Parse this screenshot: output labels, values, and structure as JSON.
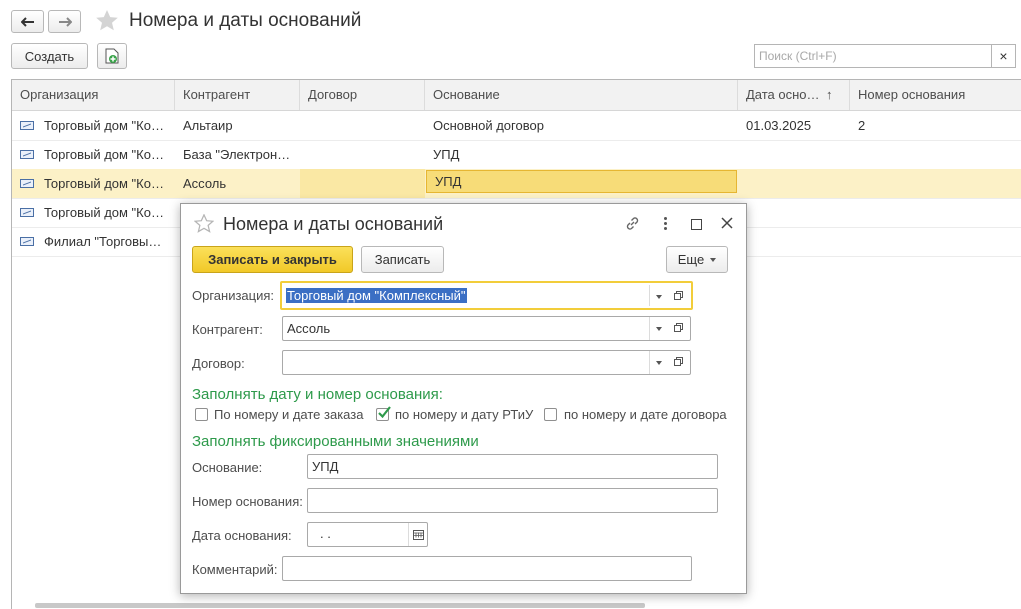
{
  "window": {
    "title": "Номера и даты оснований",
    "create_label": "Создать",
    "search_placeholder": "Поиск (Ctrl+F)",
    "search_clear": "×"
  },
  "table": {
    "columns": [
      "Организация",
      "Контрагент",
      "Договор",
      "Основание",
      "Дата осно…",
      "Номер основания"
    ],
    "sort_indicator": "↑",
    "rows": [
      {
        "org": "Торговый дом \"Ко…",
        "contractor": "Альтаир",
        "contract": "",
        "basis": "Основной договор",
        "date": "01.03.2025",
        "number": "2"
      },
      {
        "org": "Торговый дом \"Ко…",
        "contractor": "База \"Электрон…",
        "contract": "",
        "basis": "УПД",
        "date": "",
        "number": ""
      },
      {
        "org": "Торговый дом \"Ко…",
        "contractor": "Ассоль",
        "contract": "",
        "basis": "УПД",
        "date": "",
        "number": ""
      },
      {
        "org": "Торговый дом \"Ко…",
        "contractor": "",
        "contract": "",
        "basis": "",
        "date": "",
        "number": ""
      },
      {
        "org": "Филиал \"Торговы…",
        "contractor": "",
        "contract": "",
        "basis": "",
        "date": "",
        "number": ""
      }
    ]
  },
  "dialog": {
    "title": "Номера и даты оснований",
    "save_close_label": "Записать и закрыть",
    "save_label": "Записать",
    "more_label": "Еще",
    "org_label": "Организация:",
    "org_value": "Торговый дом \"Комплексный\"",
    "contractor_label": "Контрагент:",
    "contractor_value": "Ассоль",
    "contract_label": "Договор:",
    "contract_value": "",
    "section1": "Заполнять дату и номер основания:",
    "opt1": "По номеру и дате заказа",
    "opt2": "по номеру и дату РТиУ",
    "opt3": "по номеру и дате договора",
    "opt_checked": [
      false,
      true,
      false
    ],
    "section2": "Заполнять фиксированными значениями",
    "basis_label": "Основание:",
    "basis_value": "УПД",
    "basis_number_label": "Номер основания:",
    "basis_number_value": "",
    "basis_date_label": "Дата основания:",
    "basis_date_value": ".  .",
    "comment_label": "Комментарий:",
    "comment_value": ""
  },
  "colors": {
    "accent_yellow": "#f5d22b",
    "selected_row": "#fcf1c7",
    "section_green": "#2e9a4b"
  }
}
